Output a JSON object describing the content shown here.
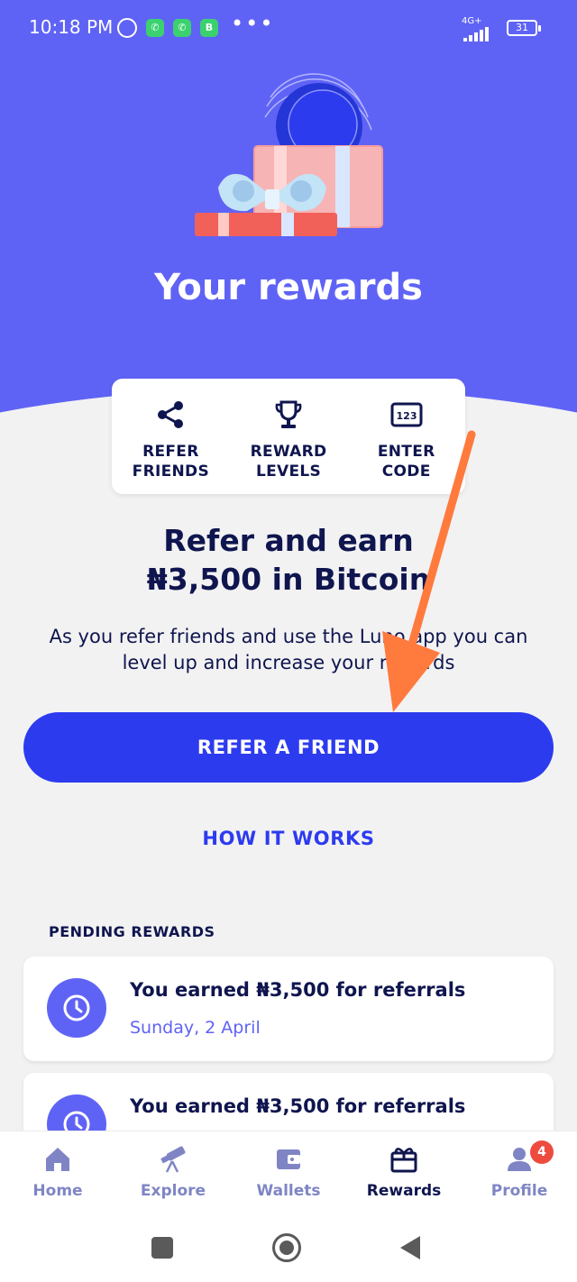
{
  "status_bar": {
    "time": "10:18 PM",
    "app_icons": [
      "whatsapp-icon",
      "whatsapp-icon",
      "whatsapp-business-icon"
    ],
    "app_badge_letter": "B",
    "more": "•••",
    "network": "4G+",
    "battery": "31"
  },
  "hero": {
    "title": "Your rewards",
    "background_color": "#5f63f5"
  },
  "quick_actions": [
    {
      "label": "REFER\nFRIENDS",
      "icon": "share-icon"
    },
    {
      "label": "REWARD\nLEVELS",
      "icon": "trophy-icon"
    },
    {
      "label": "ENTER\nCODE",
      "icon": "code-123-icon"
    }
  ],
  "code_icon_text": "123",
  "refer": {
    "title_line1": "Refer and earn",
    "title_line2": "₦3,500 in Bitcoin",
    "subtitle": "As you refer friends and use the Luno app you can level up and increase your rewards",
    "button_label": "REFER A FRIEND",
    "how_link": "HOW IT WORKS"
  },
  "pending": {
    "heading": "PENDING REWARDS",
    "items": [
      {
        "title": "You earned ₦3,500 for referrals",
        "date": "Sunday, 2 April"
      },
      {
        "title": "You earned ₦3,500 for referrals",
        "date": ""
      }
    ]
  },
  "bottom_nav": [
    {
      "label": "Home",
      "icon": "home-icon",
      "active": false
    },
    {
      "label": "Explore",
      "icon": "telescope-icon",
      "active": false
    },
    {
      "label": "Wallets",
      "icon": "wallet-icon",
      "active": false
    },
    {
      "label": "Rewards",
      "icon": "gift-icon",
      "active": true
    },
    {
      "label": "Profile",
      "icon": "user-icon",
      "active": false,
      "badge": "4"
    }
  ],
  "colors": {
    "accent": "#2d3bef",
    "navy": "#0f154e",
    "annotation_arrow": "#ff7a3d"
  }
}
